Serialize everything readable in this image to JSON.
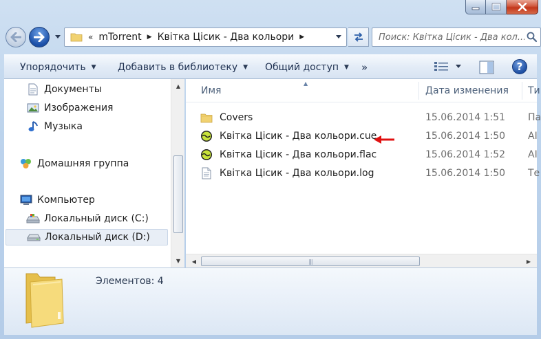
{
  "window": {
    "controls": {
      "minimize": "minimize",
      "maximize": "maximize",
      "close": "close"
    }
  },
  "navbar": {
    "overflow": "«",
    "breadcrumbs": [
      {
        "label": "mTorrent"
      },
      {
        "label": "Квітка Цісик - Два кольори"
      }
    ],
    "search_placeholder": "Поиск: Квітка Цісик - Два кол..."
  },
  "commandbar": {
    "organize": "Упорядочить",
    "add_to_library": "Добавить в библиотеку",
    "share": "Общий доступ",
    "more": "»"
  },
  "sidebar": {
    "items": [
      {
        "label": "Документы",
        "icon": "documents-icon"
      },
      {
        "label": "Изображения",
        "icon": "pictures-icon"
      },
      {
        "label": "Музыка",
        "icon": "music-icon"
      },
      {
        "label": "Домашняя группа",
        "icon": "homegroup-icon"
      },
      {
        "label": "Компьютер",
        "icon": "computer-icon"
      },
      {
        "label": "Локальный диск (C:)",
        "icon": "drive-c-icon"
      },
      {
        "label": "Локальный диск (D:)",
        "icon": "drive-d-icon",
        "selected": true
      }
    ]
  },
  "filelist": {
    "columns": {
      "name": "Имя",
      "date": "Дата изменения",
      "type": "Ти"
    },
    "rows": [
      {
        "name": "Covers",
        "date": "15.06.2014 1:51",
        "type": "Па",
        "icon": "folder-icon"
      },
      {
        "name": "Квітка Цісик - Два кольори.cue",
        "date": "15.06.2014 1:50",
        "type": "AI",
        "icon": "aimp-icon",
        "highlighted": true
      },
      {
        "name": "Квітка Цісик - Два кольори.flac",
        "date": "15.06.2014 1:52",
        "type": "AI",
        "icon": "aimp-icon"
      },
      {
        "name": "Квітка Цісик - Два кольори.log",
        "date": "15.06.2014 1:50",
        "type": "Те",
        "icon": "text-file-icon"
      }
    ]
  },
  "details": {
    "item_count": "Элементов: 4"
  },
  "colors": {
    "accent_arrow": "#e01010",
    "folder": "#f1d271"
  }
}
